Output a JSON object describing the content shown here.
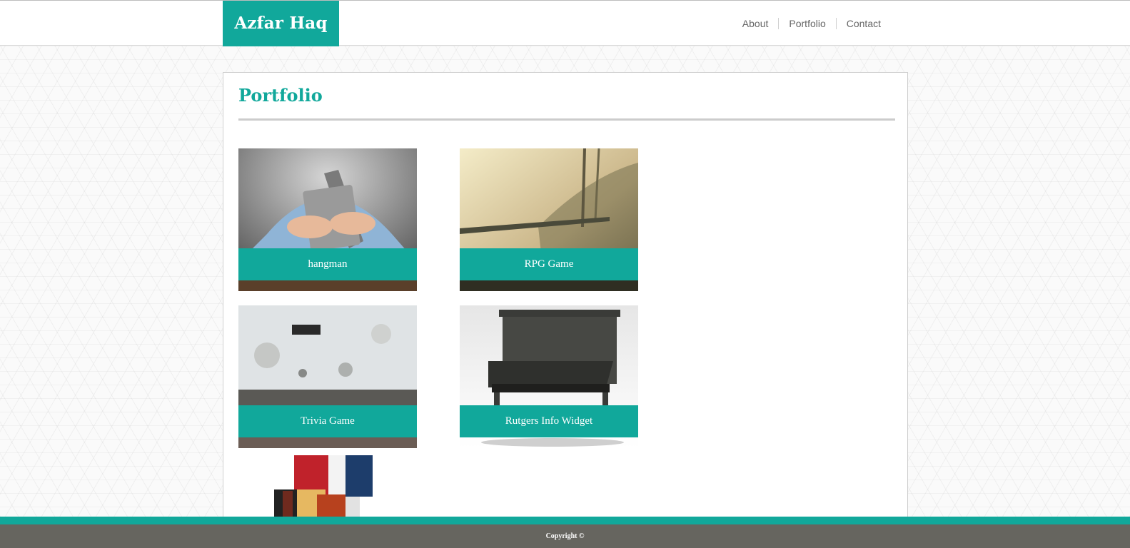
{
  "header": {
    "brand": "Azfar Haq",
    "nav": [
      {
        "label": "About"
      },
      {
        "label": "Portfolio"
      },
      {
        "label": "Contact"
      }
    ]
  },
  "main": {
    "title": "Portfolio",
    "projects": [
      {
        "caption": "hangman",
        "image": "laptop-frustration-photo"
      },
      {
        "caption": "RPG Game",
        "image": "foggy-forest-photo"
      },
      {
        "caption": "Trivia Game",
        "image": "concrete-wall-photo"
      },
      {
        "caption": "Rutgers Info Widget",
        "image": "piano-photo"
      },
      {
        "caption": "",
        "image": "ribbon-medal-photo"
      }
    ]
  },
  "footer": {
    "copyright": "Copyright ©"
  },
  "colors": {
    "accent": "#11a89b",
    "footer_bg": "#66655f"
  }
}
